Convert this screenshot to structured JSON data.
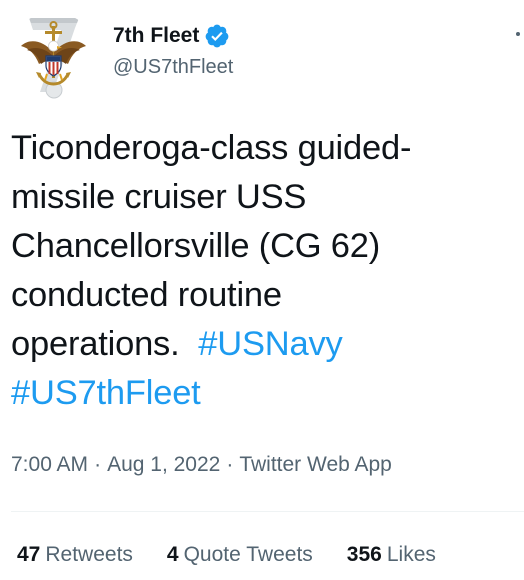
{
  "colors": {
    "text_primary": "#0f1419",
    "text_secondary": "#536471",
    "link": "#1d9bf0",
    "verified": "#1d9bf0",
    "divider": "#eff3f4"
  },
  "author": {
    "display_name": "7th Fleet",
    "handle": "@US7thFleet",
    "verified": true,
    "avatar_icon": "navy-eagle-anchor-emblem-icon",
    "verified_icon": "verified-badge-icon"
  },
  "tweet": {
    "text_lines": [
      "Ticonderoga-class guided-",
      "missile cruiser USS",
      "Chancellorsville (CG 62)",
      "conducted routine",
      "operations.  "
    ],
    "hashtags": [
      "#USNavy",
      "#US7thFleet"
    ]
  },
  "meta": {
    "time": "7:00 AM",
    "separator": "·",
    "date": "Aug 1, 2022",
    "source": "Twitter Web App"
  },
  "stats": {
    "retweets_count": "47",
    "retweets_label": "Retweets",
    "quote_count": "4",
    "quote_label": "Quote Tweets",
    "likes_count": "356",
    "likes_label": "Likes"
  },
  "more_icon": "more-options-icon"
}
